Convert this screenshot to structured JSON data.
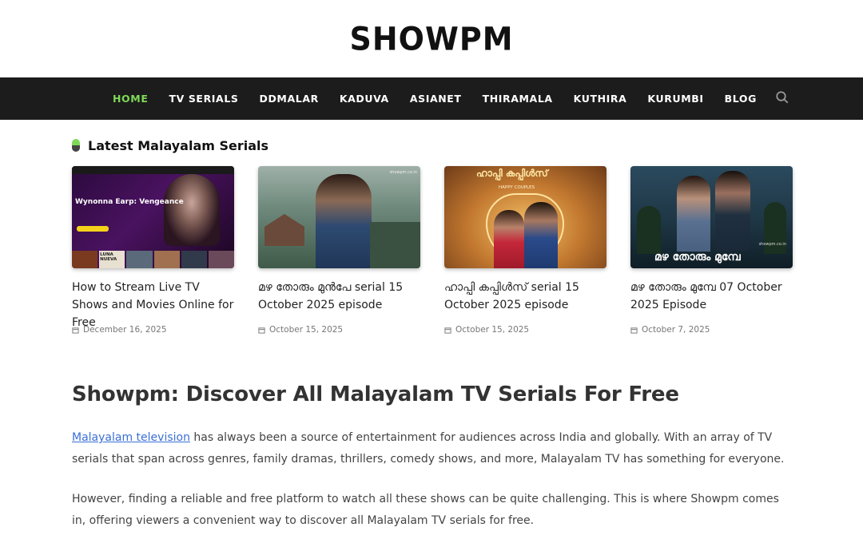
{
  "site": {
    "logo": "SHOWPM"
  },
  "nav": {
    "items": [
      {
        "label": "HOME",
        "active": true
      },
      {
        "label": "TV SERIALS"
      },
      {
        "label": "DDMALAR"
      },
      {
        "label": "KADUVA"
      },
      {
        "label": "ASIANET"
      },
      {
        "label": "THIRAMALA"
      },
      {
        "label": "KUTHIRA"
      },
      {
        "label": "KURUMBI"
      },
      {
        "label": "BLOG"
      }
    ],
    "search_icon": "search-icon"
  },
  "latest": {
    "title": "Latest Malayalam Serials",
    "cards": [
      {
        "title": "How to Stream Live TV Shows and Movies Online for Free",
        "date": "December 16, 2025",
        "thumb_text": "Wynonna Earp: Vengeance",
        "thumb_text2": "LUNA NUEVA"
      },
      {
        "title": "മഴ തോരും മുൻപേ serial 15 October 2025 episode",
        "date": "October 15, 2025",
        "thumb_text": "showpm.co.in"
      },
      {
        "title": "ഹാപ്പി കപ്പിൾസ് serial 15 October 2025 episode",
        "date": "October 15, 2025",
        "thumb_text": "ഹാപ്പി കപ്പിൾസ്",
        "thumb_text2": "HAPPY COUPLES"
      },
      {
        "title": "മഴ തോരും മുമ്പേ 07 October 2025 Episode",
        "date": "October 7, 2025",
        "thumb_text": "മഴ തോരും മുമ്പേ",
        "thumb_text2": "showpm.co.in"
      }
    ]
  },
  "article": {
    "heading": "Showpm: Discover All Malayalam TV Serials For Free",
    "p1_link": "Malayalam television",
    "p1_rest": " has always been a source of entertainment for audiences across India and globally. With an array of TV serials that span across genres, family dramas, thrillers, comedy shows, and more, Malayalam TV has something for everyone.",
    "p2": "However, finding a reliable and free platform to watch all these shows can be quite challenging. This is where Showpm comes in, offering viewers a convenient way to discover all Malayalam TV serials for free."
  },
  "colors": {
    "accent": "#7ed957",
    "nav_bg": "#1c1c1c",
    "link": "#3a6fd8"
  }
}
